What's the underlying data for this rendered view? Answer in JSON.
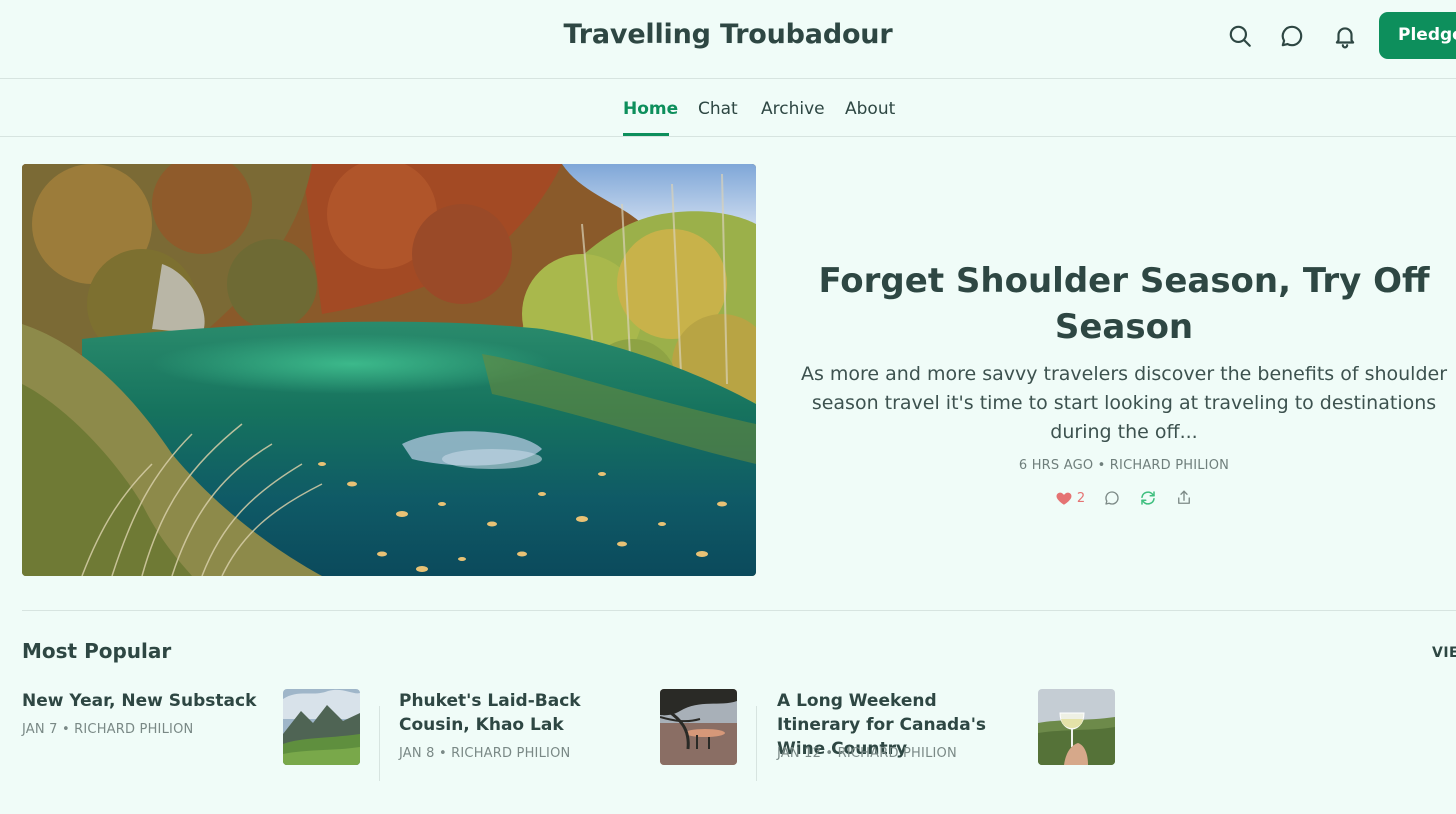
{
  "header": {
    "site_title": "Travelling Troubadour",
    "pledge_label": "Pledge",
    "icons": [
      "search-icon",
      "chat-icon",
      "bell-icon"
    ]
  },
  "nav": {
    "tabs": [
      {
        "label": "Home",
        "active": true
      },
      {
        "label": "Chat",
        "active": false
      },
      {
        "label": "Archive",
        "active": false
      },
      {
        "label": "About",
        "active": false
      }
    ]
  },
  "featured": {
    "title": "Forget Shoulder Season, Try Off Season",
    "subtitle": "As more and more savvy travelers discover the benefits of shoulder season travel it's time to start looking at traveling to destinations during the off...",
    "meta": "6 HRS AGO • RICHARD PHILION",
    "like_count": "2"
  },
  "most_popular": {
    "heading": "Most Popular",
    "view_all_label": "VIEW ALL",
    "posts": [
      {
        "title": "New Year, New Substack",
        "meta": "JAN 7 • RICHARD PHILION"
      },
      {
        "title": "Phuket's Laid-Back Cousin, Khao Lak",
        "meta": "JAN 8 • RICHARD PHILION"
      },
      {
        "title": "A Long Weekend Itinerary for Canada's Wine Country",
        "meta": "JAN 12 • RICHARD PHILION"
      }
    ]
  },
  "colors": {
    "background": "#f0fcf8",
    "accent": "#0d8f5c",
    "text": "#2e4743",
    "like": "#e57373"
  }
}
